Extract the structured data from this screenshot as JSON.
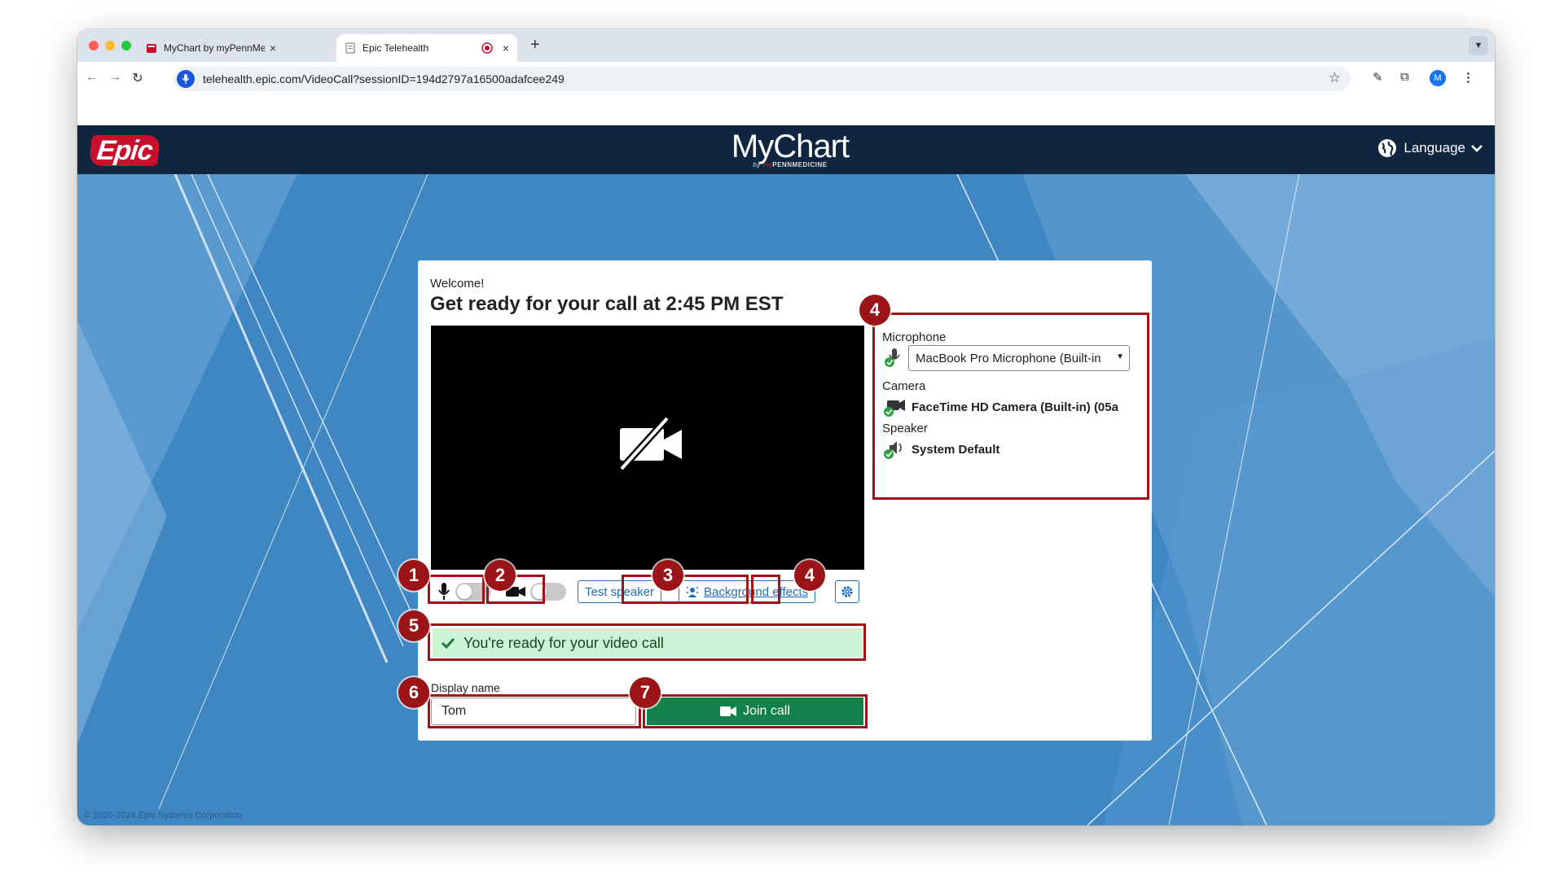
{
  "browser": {
    "tabs": [
      {
        "title": "MyChart by myPennMedicine",
        "close": "×"
      },
      {
        "title": "Epic Telehealth",
        "close": "×"
      }
    ],
    "new_tab": "+",
    "url": "telehealth.epic.com/VideoCall?sessionID=194d2797a16500adafcee249",
    "profile_initial": "M"
  },
  "header": {
    "brand": "Epic",
    "logo_text": "MyChart",
    "logo_sub_by": "by ",
    "logo_sub_my": "my",
    "logo_sub_org": "PENNMEDICINE",
    "language_label": "Language"
  },
  "card": {
    "welcome": "Welcome!",
    "title": "Get ready for your call at 2:45 PM EST",
    "test_speaker": "Test speaker",
    "background_effects": "Background effects",
    "ready_message": "You're ready for your video call",
    "display_name_label": "Display name",
    "display_name_value": "Tom",
    "join_label": "Join call"
  },
  "devices": {
    "microphone_label": "Microphone",
    "microphone_value": "MacBook Pro Microphone (Built-in",
    "camera_label": "Camera",
    "camera_value": "FaceTime HD Camera (Built-in) (05a",
    "speaker_label": "Speaker",
    "speaker_value": "System Default"
  },
  "callouts": [
    "1",
    "2",
    "3",
    "4",
    "4",
    "5",
    "6",
    "7"
  ],
  "footer": {
    "copyright": "© 2020-2024 Epic Systems Corporation"
  },
  "colors": {
    "callout": "#9b1418",
    "join_button": "#12824a",
    "background_blue": "#3e87c3",
    "header_navy": "#0f2540"
  }
}
